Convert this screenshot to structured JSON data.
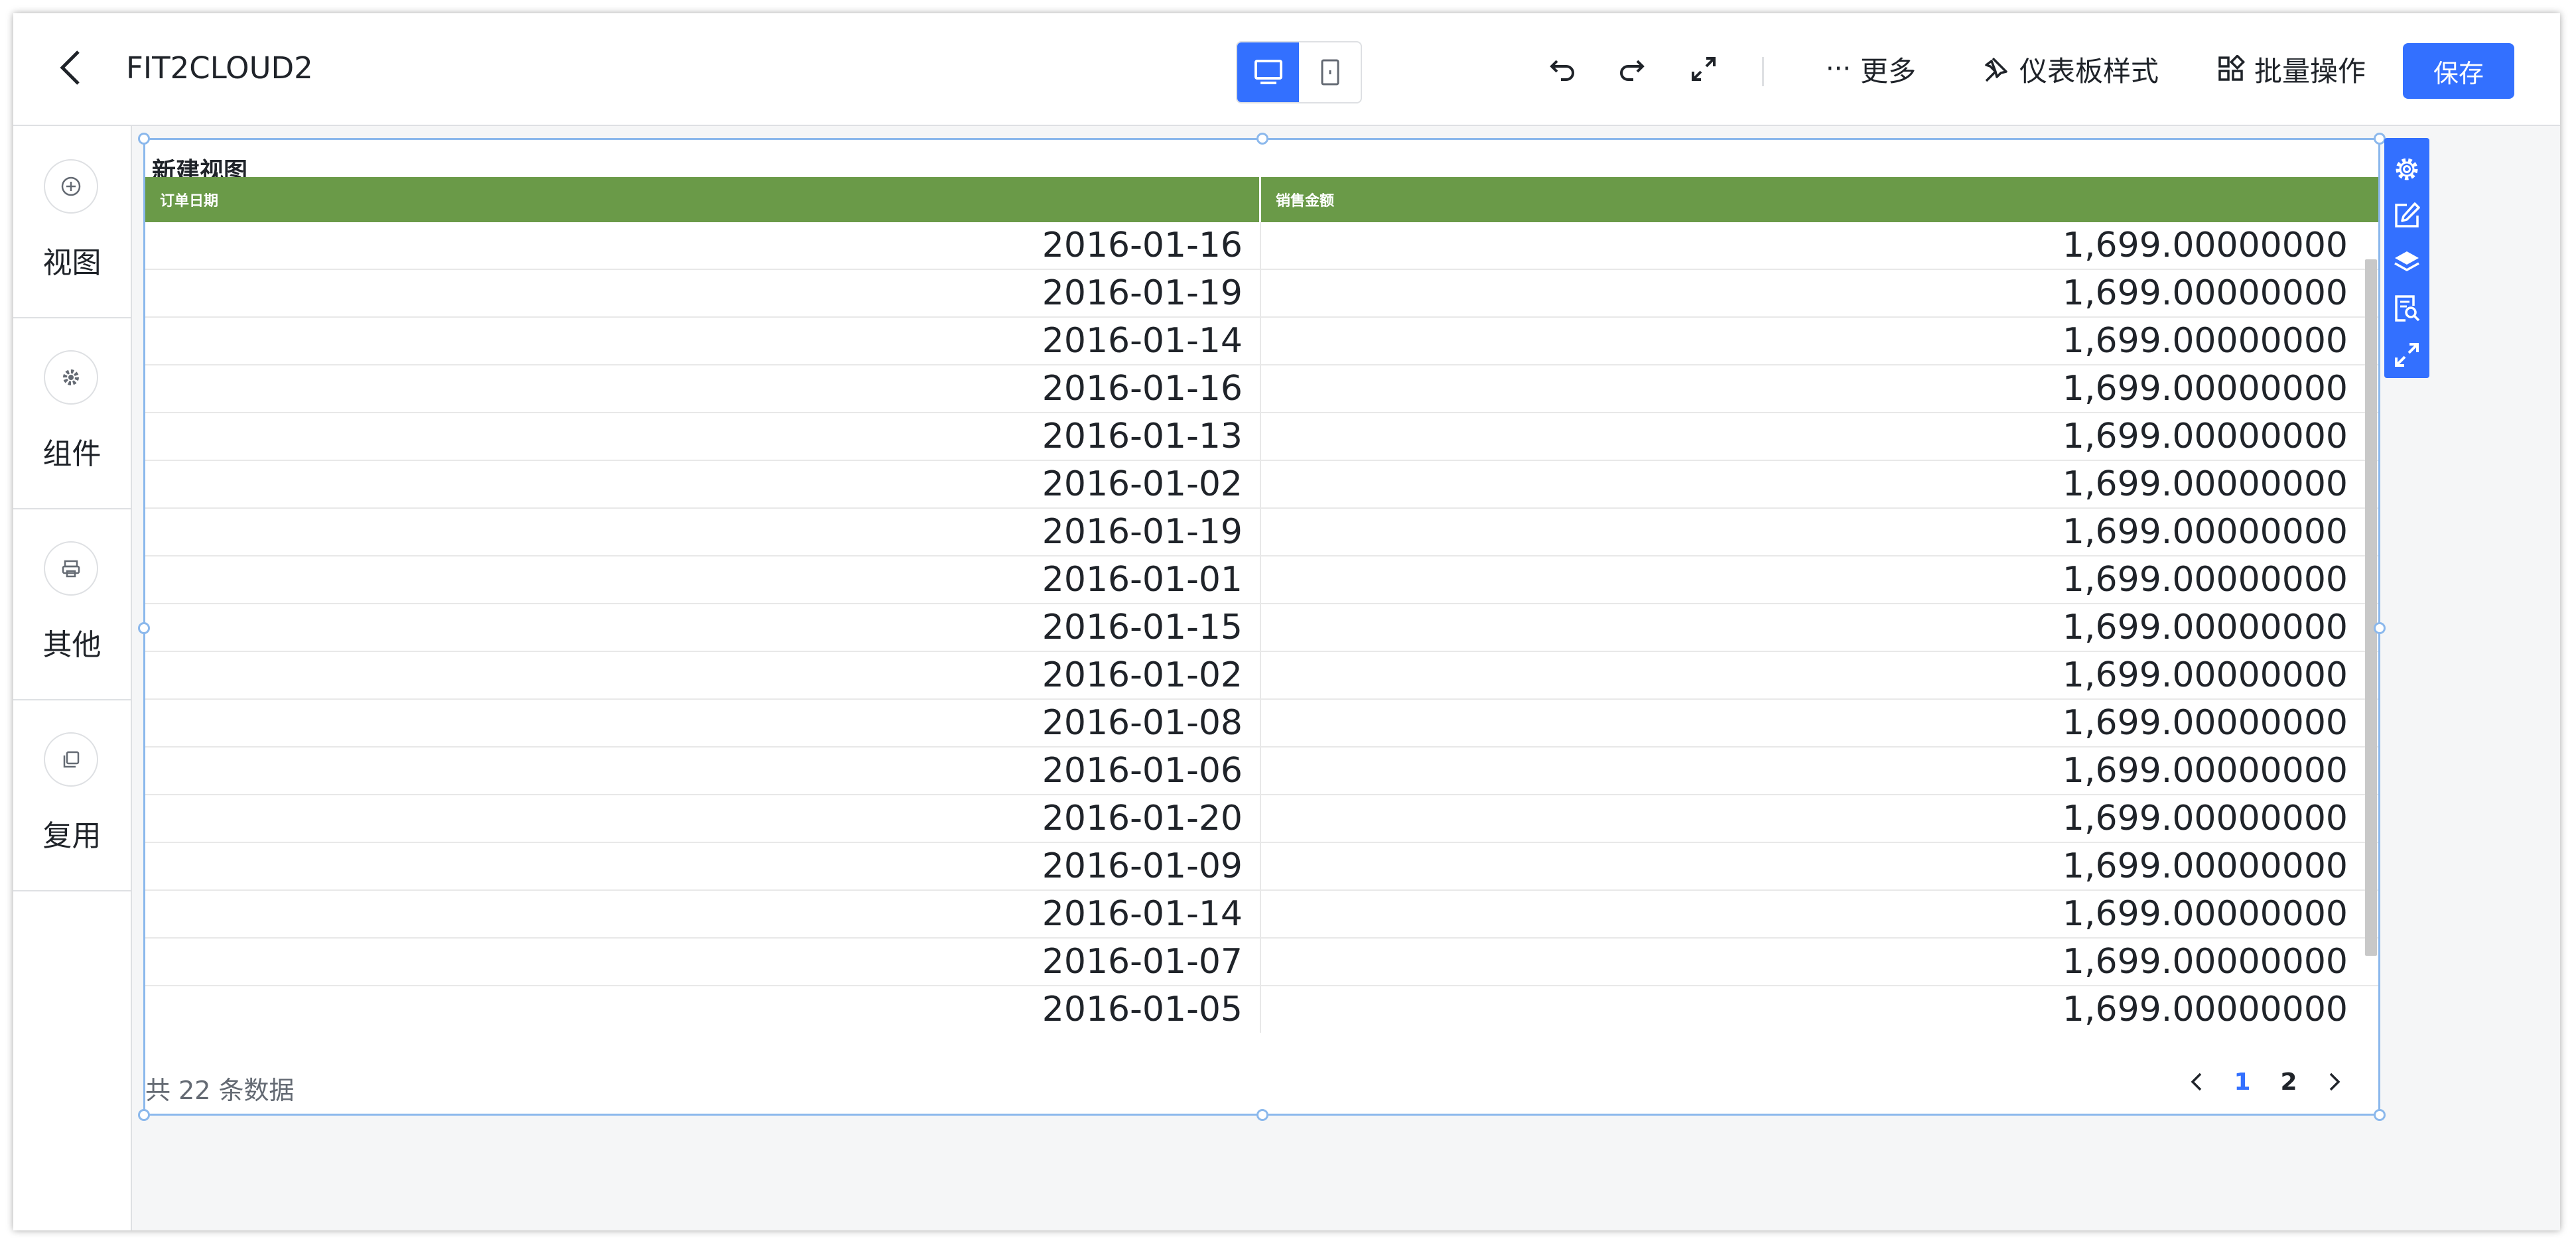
{
  "header": {
    "title": "FIT2CLOUD2",
    "more_label": "更多",
    "style_label": "仪表板样式",
    "batch_label": "批量操作",
    "save_label": "保存"
  },
  "sidebar": {
    "items": [
      {
        "label": "视图",
        "icon": "plus-circle-icon"
      },
      {
        "label": "组件",
        "icon": "gear-icon"
      },
      {
        "label": "其他",
        "icon": "printer-icon"
      },
      {
        "label": "复用",
        "icon": "copy-icon"
      }
    ]
  },
  "view": {
    "title": "新建视图",
    "columns": [
      "订单日期",
      "销售金额"
    ],
    "rows": [
      [
        "2016-01-16",
        "1,699.00000000"
      ],
      [
        "2016-01-19",
        "1,699.00000000"
      ],
      [
        "2016-01-14",
        "1,699.00000000"
      ],
      [
        "2016-01-16",
        "1,699.00000000"
      ],
      [
        "2016-01-13",
        "1,699.00000000"
      ],
      [
        "2016-01-02",
        "1,699.00000000"
      ],
      [
        "2016-01-19",
        "1,699.00000000"
      ],
      [
        "2016-01-01",
        "1,699.00000000"
      ],
      [
        "2016-01-15",
        "1,699.00000000"
      ],
      [
        "2016-01-02",
        "1,699.00000000"
      ],
      [
        "2016-01-08",
        "1,699.00000000"
      ],
      [
        "2016-01-06",
        "1,699.00000000"
      ],
      [
        "2016-01-20",
        "1,699.00000000"
      ],
      [
        "2016-01-09",
        "1,699.00000000"
      ],
      [
        "2016-01-14",
        "1,699.00000000"
      ],
      [
        "2016-01-07",
        "1,699.00000000"
      ],
      [
        "2016-01-05",
        "1,699.00000000"
      ]
    ],
    "total_text": "共 22 条数据",
    "pages": [
      "1",
      "2"
    ],
    "current_page": "1"
  },
  "colors": {
    "accent": "#3370ff",
    "table_header": "#6a9a48",
    "selection_border": "#8bb8ec"
  }
}
